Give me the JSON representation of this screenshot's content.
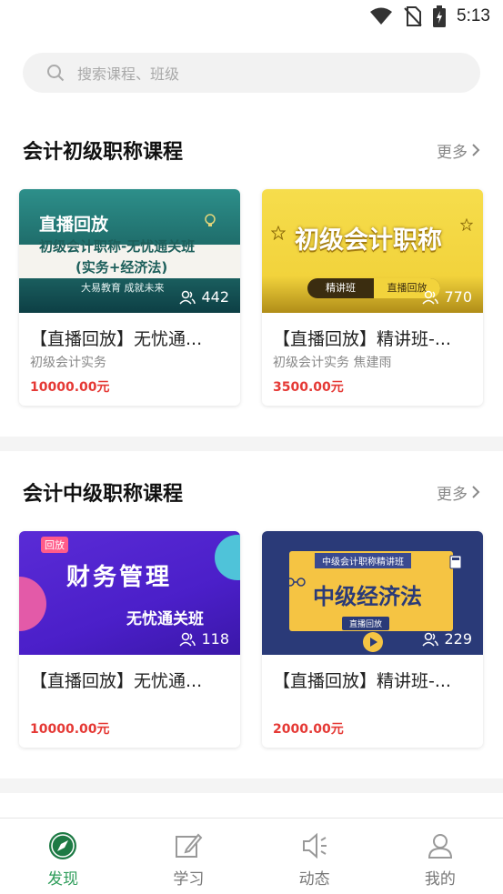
{
  "status": {
    "time": "5:13"
  },
  "search": {
    "placeholder": "搜索课程、班级"
  },
  "sections": [
    {
      "title": "会计初级职称课程",
      "more": "更多",
      "cards": [
        {
          "thumb": {
            "heading": "直播回放",
            "line1": "初级会计职称-无忧通关班",
            "line2": "(实务+经济法)",
            "footer": "大易教育  成就未来"
          },
          "viewers": "442",
          "title": "【直播回放】无忧通...",
          "subtitle": "初级会计实务",
          "price": "10000.00元"
        },
        {
          "thumb": {
            "heading": "初级会计职称",
            "tag1": "精讲班",
            "tag2": "直播回放"
          },
          "viewers": "770",
          "title": "【直播回放】精讲班-...",
          "subtitle": "初级会计实务 焦建雨",
          "price": "3500.00元"
        }
      ]
    },
    {
      "title": "会计中级职称课程",
      "more": "更多",
      "cards": [
        {
          "thumb": {
            "badge": "回放",
            "heading": "财务管理",
            "line1": "无忧通关班"
          },
          "viewers": "118",
          "title": "【直播回放】无忧通...",
          "subtitle": "",
          "price": "10000.00元"
        },
        {
          "thumb": {
            "banner": "中级会计职称精讲班",
            "heading": "中级经济法",
            "tag": "直播回放"
          },
          "viewers": "229",
          "title": "【直播回放】精讲班-...",
          "subtitle": "",
          "price": "2000.00元"
        }
      ]
    }
  ],
  "tabs": [
    {
      "label": "发现",
      "icon": "compass-icon",
      "active": true
    },
    {
      "label": "学习",
      "icon": "edit-icon",
      "active": false
    },
    {
      "label": "动态",
      "icon": "speaker-icon",
      "active": false
    },
    {
      "label": "我的",
      "icon": "person-icon",
      "active": false
    }
  ],
  "colors": {
    "accent": "#2e9d5a",
    "price": "#e53935"
  }
}
